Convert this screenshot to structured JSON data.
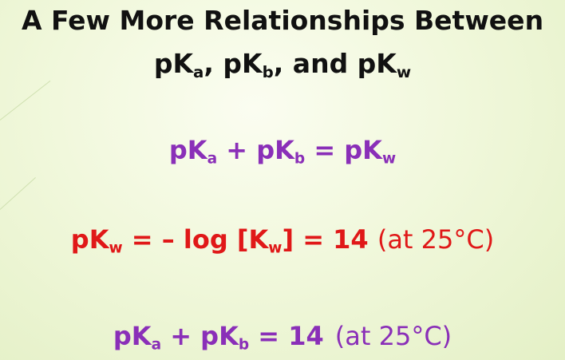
{
  "title": {
    "line1": "A Few More Relationships Between",
    "line2": {
      "p1": "pK",
      "s1": "a",
      "sep1": ", pK",
      "s2": "b",
      "sep2": ", and pK",
      "s3": "w"
    }
  },
  "equation1": {
    "t1": "pK",
    "s1": "a",
    "t2": " + pK",
    "s2": "b",
    "t3": " = pK",
    "s3": "w"
  },
  "equation2": {
    "t1": "pK",
    "s1": "w",
    "t2": " = – log [K",
    "s2": "w",
    "t3": "] = 14 ",
    "note": "(at 25°C)"
  },
  "equation3": {
    "t1": "pK",
    "s1": "a",
    "t2": " + pK",
    "s2": "b",
    "t3": " = 14",
    "note": "(at 25°C)"
  },
  "colors": {
    "title": "#111111",
    "purple": "#8a2fb8",
    "red": "#e01818",
    "background": "#eef6d8"
  }
}
